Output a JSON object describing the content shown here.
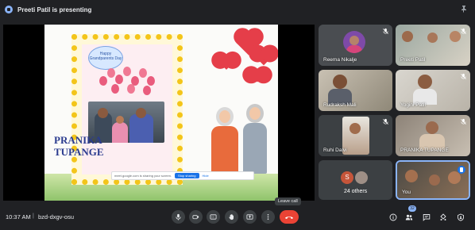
{
  "header": {
    "presenting_text": "Preeti Patil is presenting"
  },
  "slide": {
    "badge_text": "Happy Grandparents Day",
    "name_line1": "PRANIKA",
    "name_line2": "TUPANGE",
    "share_notice": "meet.google.com is sharing your screen.",
    "stop_sharing_label": "Stop sharing",
    "hide_label": "Hide"
  },
  "participants": [
    {
      "name": "Reema Nikalje",
      "muted": true
    },
    {
      "name": "Preeti Patil",
      "muted": true
    },
    {
      "name": "Rudraksh Mali",
      "muted": false
    },
    {
      "name": "Yogini Patil",
      "muted": true
    },
    {
      "name": "Ruhi Dalvi",
      "muted": true
    },
    {
      "name": "PRANIKA TUPANGE",
      "muted": true
    },
    {
      "name": "24 others",
      "avatar_letter": "S"
    },
    {
      "name": "You",
      "speaking": true
    }
  ],
  "footer": {
    "time": "10:37 AM",
    "separator": "|",
    "meeting_code": "bzd-dxgv-osu",
    "leave_tooltip": "Leave call",
    "people_count": "32"
  },
  "colors": {
    "background": "#202124",
    "tile": "#3c4043",
    "leave_red": "#ea4335",
    "accent_blue": "#8ab4f8"
  },
  "icons": [
    "present-icon",
    "pin-icon",
    "mic-off-icon",
    "mic-icon",
    "camera-icon",
    "captions-icon",
    "raise-hand-icon",
    "present-screen-icon",
    "more-options-icon",
    "call-end-icon",
    "info-icon",
    "people-icon",
    "chat-icon",
    "activities-icon",
    "host-controls-icon"
  ]
}
